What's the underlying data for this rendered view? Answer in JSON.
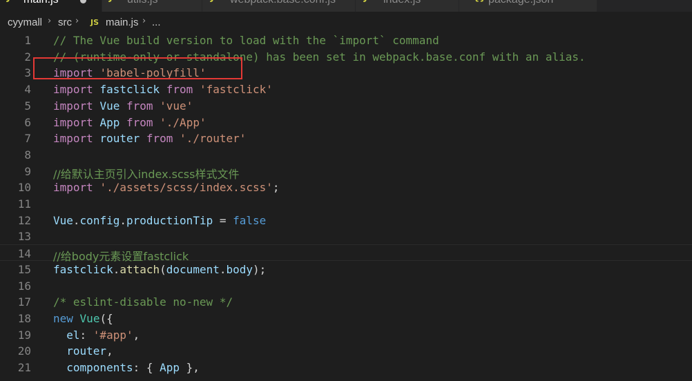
{
  "tabs": [
    {
      "label": "main.js",
      "icon": "JS",
      "active": true,
      "dirty": true
    },
    {
      "label": "utils.js",
      "icon": "JS",
      "active": false
    },
    {
      "label": "webpack.base.conf.js",
      "icon": "JS",
      "active": false
    },
    {
      "label": "index.js",
      "icon": "JS",
      "active": false
    },
    {
      "label": "package.json",
      "icon": "{}",
      "active": false
    }
  ],
  "breadcrumb": {
    "items": [
      "cyymall",
      "src",
      "main.js",
      "..."
    ],
    "file_icon": "JS"
  },
  "code": {
    "lines": [
      [
        {
          "t": "// The Vue build version to load with the `import` command",
          "c": "cm"
        }
      ],
      [
        {
          "t": "// (runtime-only or standalone) has been set in webpack.base.conf with an alias.",
          "c": "cm"
        }
      ],
      [
        {
          "t": "import",
          "c": "kw"
        },
        {
          "t": " ",
          "c": "pl"
        },
        {
          "t": "'babel-polyfill'",
          "c": "str"
        }
      ],
      [
        {
          "t": "import",
          "c": "kw"
        },
        {
          "t": " ",
          "c": "pl"
        },
        {
          "t": "fastclick",
          "c": "var"
        },
        {
          "t": " ",
          "c": "pl"
        },
        {
          "t": "from",
          "c": "kw"
        },
        {
          "t": " ",
          "c": "pl"
        },
        {
          "t": "'fastclick'",
          "c": "str"
        }
      ],
      [
        {
          "t": "import",
          "c": "kw"
        },
        {
          "t": " ",
          "c": "pl"
        },
        {
          "t": "Vue",
          "c": "var"
        },
        {
          "t": " ",
          "c": "pl"
        },
        {
          "t": "from",
          "c": "kw"
        },
        {
          "t": " ",
          "c": "pl"
        },
        {
          "t": "'vue'",
          "c": "str"
        }
      ],
      [
        {
          "t": "import",
          "c": "kw"
        },
        {
          "t": " ",
          "c": "pl"
        },
        {
          "t": "App",
          "c": "var"
        },
        {
          "t": " ",
          "c": "pl"
        },
        {
          "t": "from",
          "c": "kw"
        },
        {
          "t": " ",
          "c": "pl"
        },
        {
          "t": "'./App'",
          "c": "str"
        }
      ],
      [
        {
          "t": "import",
          "c": "kw"
        },
        {
          "t": " ",
          "c": "pl"
        },
        {
          "t": "router",
          "c": "var"
        },
        {
          "t": " ",
          "c": "pl"
        },
        {
          "t": "from",
          "c": "kw"
        },
        {
          "t": " ",
          "c": "pl"
        },
        {
          "t": "'./router'",
          "c": "str"
        }
      ],
      [],
      [
        {
          "t": "//给默认主页引入index.scss样式文件",
          "c": "cm"
        }
      ],
      [
        {
          "t": "import",
          "c": "kw"
        },
        {
          "t": " ",
          "c": "pl"
        },
        {
          "t": "'./assets/scss/index.scss'",
          "c": "str"
        },
        {
          "t": ";",
          "c": "pl"
        }
      ],
      [],
      [
        {
          "t": "Vue",
          "c": "var"
        },
        {
          "t": ".",
          "c": "pl"
        },
        {
          "t": "config",
          "c": "var"
        },
        {
          "t": ".",
          "c": "pl"
        },
        {
          "t": "productionTip",
          "c": "var"
        },
        {
          "t": " = ",
          "c": "pl"
        },
        {
          "t": "false",
          "c": "kw2"
        }
      ],
      [],
      [
        {
          "t": "//给body元素设置fastclick",
          "c": "cm"
        }
      ],
      [
        {
          "t": "fastclick",
          "c": "var"
        },
        {
          "t": ".",
          "c": "pl"
        },
        {
          "t": "attach",
          "c": "fn"
        },
        {
          "t": "(",
          "c": "pl"
        },
        {
          "t": "document",
          "c": "var"
        },
        {
          "t": ".",
          "c": "pl"
        },
        {
          "t": "body",
          "c": "var"
        },
        {
          "t": ");",
          "c": "pl"
        }
      ],
      [],
      [
        {
          "t": "/* eslint-disable no-new */",
          "c": "cm"
        }
      ],
      [
        {
          "t": "new",
          "c": "kw2"
        },
        {
          "t": " ",
          "c": "pl"
        },
        {
          "t": "Vue",
          "c": "cls"
        },
        {
          "t": "({",
          "c": "pl"
        }
      ],
      [
        {
          "t": "  ",
          "c": "pl"
        },
        {
          "t": "el",
          "c": "var"
        },
        {
          "t": ": ",
          "c": "pl"
        },
        {
          "t": "'#app'",
          "c": "str"
        },
        {
          "t": ",",
          "c": "pl"
        }
      ],
      [
        {
          "t": "  ",
          "c": "pl"
        },
        {
          "t": "router",
          "c": "var"
        },
        {
          "t": ",",
          "c": "pl"
        }
      ],
      [
        {
          "t": "  ",
          "c": "pl"
        },
        {
          "t": "components",
          "c": "var"
        },
        {
          "t": ": { ",
          "c": "pl"
        },
        {
          "t": "App",
          "c": "var"
        },
        {
          "t": " },",
          "c": "pl"
        }
      ]
    ],
    "current_line": 14,
    "highlighted_line": 3
  },
  "colors": {
    "background": "#1e1e1e",
    "highlight_box": "#e53935",
    "keyword": "#c586c0",
    "string": "#ce9178",
    "comment": "#6a9955",
    "variable": "#9cdcfe"
  }
}
